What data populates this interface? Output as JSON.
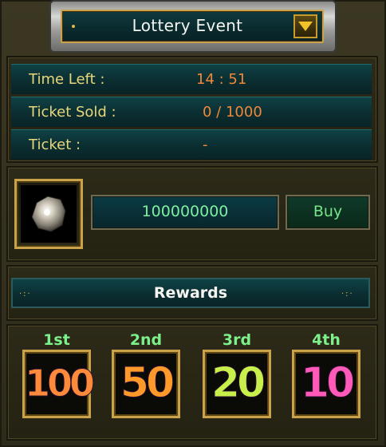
{
  "header": {
    "title": "Lottery Event",
    "dropdown_icon": "chevron-down-icon"
  },
  "info": {
    "rows": [
      {
        "label": "Time Left :",
        "value": "14 : 51"
      },
      {
        "label": "Ticket Sold :",
        "value": "0 / 1000"
      },
      {
        "label": "Ticket :",
        "value": "-"
      }
    ]
  },
  "purchase": {
    "item_icon": "ticket-stone-icon",
    "amount": "100000000",
    "buy_label": "Buy"
  },
  "rewards": {
    "title": "Rewards",
    "tiers": [
      {
        "rank": "1st",
        "prize": "100"
      },
      {
        "rank": "2nd",
        "prize": "50"
      },
      {
        "rank": "3rd",
        "prize": "20"
      },
      {
        "rank": "4th",
        "prize": "10"
      }
    ]
  },
  "colors": {
    "gold_border": "#c9a24a",
    "teal_bar": "#0b2e31",
    "label_yellow": "#e8d77a",
    "value_orange": "#f0883a",
    "green_text": "#74e58a"
  }
}
